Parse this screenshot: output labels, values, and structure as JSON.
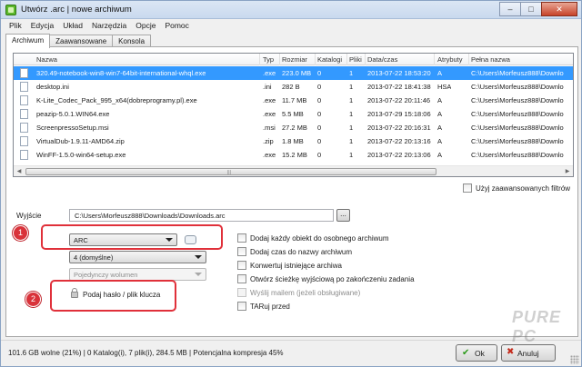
{
  "window": {
    "title": "Utwórz .arc | nowe archiwum",
    "buttons": {
      "minimize": "–",
      "maximize": "□",
      "close": "✕"
    }
  },
  "menu": [
    "Plik",
    "Edycja",
    "Układ",
    "Narzędzia",
    "Opcje",
    "Pomoc"
  ],
  "tabs": [
    "Archiwum",
    "Zaawansowane",
    "Konsola"
  ],
  "filelist": {
    "columns": [
      "Nazwa",
      "Typ",
      "Rozmiar",
      "Katalogi",
      "Pliki",
      "Data/czas",
      "Atrybuty",
      "Pełna nazwa"
    ],
    "rows": [
      {
        "name": "320.49-notebook-win8-win7-64bit-international-whql.exe",
        "type": ".exe",
        "size": "223.0 MB",
        "dirs": "0",
        "files": "1",
        "date": "2013-07-22 18:53:20",
        "attr": "A",
        "full": "C:\\Users\\Morfeusz888\\Downlo",
        "selected": true
      },
      {
        "name": "desktop.ini",
        "type": ".ini",
        "size": "282 B",
        "dirs": "0",
        "files": "1",
        "date": "2013-07-22 18:41:38",
        "attr": "HSA",
        "full": "C:\\Users\\Morfeusz888\\Downlo",
        "selected": false
      },
      {
        "name": "K-Lite_Codec_Pack_995_x64(dobreprogramy.pl).exe",
        "type": ".exe",
        "size": "11.7 MB",
        "dirs": "0",
        "files": "1",
        "date": "2013-07-22 20:11:46",
        "attr": "A",
        "full": "C:\\Users\\Morfeusz888\\Downlo",
        "selected": false
      },
      {
        "name": "peazip-5.0.1.WIN64.exe",
        "type": ".exe",
        "size": "5.5 MB",
        "dirs": "0",
        "files": "1",
        "date": "2013-07-29 15:18:06",
        "attr": "A",
        "full": "C:\\Users\\Morfeusz888\\Downlo",
        "selected": false
      },
      {
        "name": "ScreenpressoSetup.msi",
        "type": ".msi",
        "size": "27.2 MB",
        "dirs": "0",
        "files": "1",
        "date": "2013-07-22 20:16:31",
        "attr": "A",
        "full": "C:\\Users\\Morfeusz888\\Downlo",
        "selected": false
      },
      {
        "name": "VirtualDub-1.9.11-AMD64.zip",
        "type": ".zip",
        "size": "1.8 MB",
        "dirs": "0",
        "files": "1",
        "date": "2013-07-22 20:13:16",
        "attr": "A",
        "full": "C:\\Users\\Morfeusz888\\Downlo",
        "selected": false
      },
      {
        "name": "WinFF-1.5.0-win64-setup.exe",
        "type": ".exe",
        "size": "15.2 MB",
        "dirs": "0",
        "files": "1",
        "date": "2013-07-22 20:13:06",
        "attr": "A",
        "full": "C:\\Users\\Morfeusz888\\Downlo",
        "selected": false
      }
    ],
    "scroll_arrows": {
      "left": "◀",
      "right": "▶"
    },
    "scroll_grip": "|||"
  },
  "advanced_filters_label": "Użyj zaawansowanych filtrów",
  "output": {
    "label": "Wyjście",
    "path": "C:\\Users\\Morfeusz888\\Downloads\\Downloads.arc",
    "browse": "..."
  },
  "format_select": "ARC",
  "level_select": "4 (domyślne)",
  "volume_select": "Pojedynczy wolumen",
  "password_button": "Podaj hasło / plik klucza",
  "options": [
    {
      "label": "Dodaj każdy obiekt do osobnego archiwum",
      "disabled": false
    },
    {
      "label": "Dodaj czas do nazwy archiwum",
      "disabled": false
    },
    {
      "label": "Konwertuj istniejące archiwa",
      "disabled": false
    },
    {
      "label": "Otwórz ścieżkę wyjściową po zakończeniu zadania",
      "disabled": false
    },
    {
      "label": "Wyślij mailem (jeżeli obsługiwane)",
      "disabled": true
    },
    {
      "label": "TARuj przed",
      "disabled": false
    }
  ],
  "annotations": {
    "badge1": "1",
    "badge2": "2",
    "color": "#e0303a"
  },
  "status": {
    "text": "101.6 GB wolne (21%)  |  0 Katalog(i), 7 plik(i), 284.5 MB  |  Potencjalna kompresja 45%",
    "ok": "Ok",
    "ok_icon": "✔",
    "cancel": "Anuluj",
    "cancel_icon": "✖"
  },
  "watermark": "PURE PC"
}
